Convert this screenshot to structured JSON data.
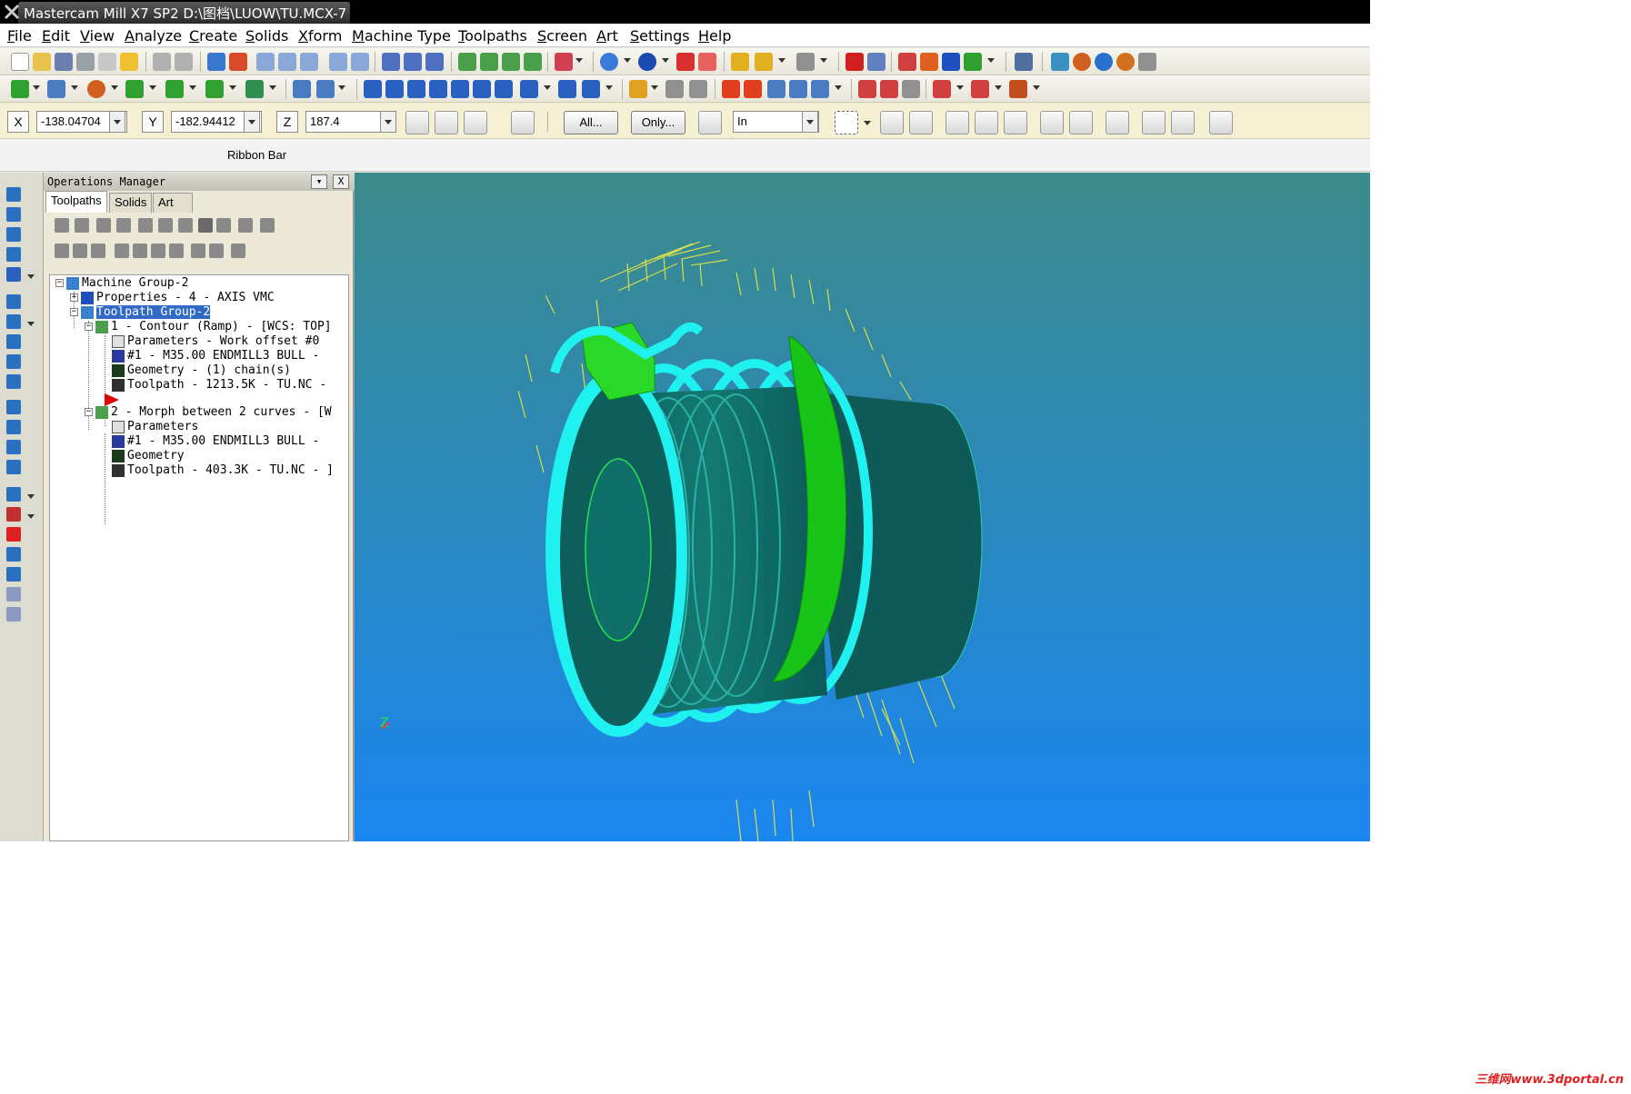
{
  "window": {
    "title": "Mastercam Mill X7 SP2  D:\\图档\\LUOW\\TU.MCX-7"
  },
  "menu": [
    "File",
    "Edit",
    "View",
    "Analyze",
    "Create",
    "Solids",
    "Xform",
    "Machine Type",
    "Toolpaths",
    "Screen",
    "Art",
    "Settings",
    "Help"
  ],
  "ribbon": {
    "x_label": "X",
    "x_value": "-138.04704",
    "y_label": "Y",
    "y_value": "-182.94412",
    "z_label": "Z",
    "z_value": "187.4",
    "all_button": "All...",
    "only_button": "Only...",
    "units_value": "In",
    "bar_label": "Ribbon Bar"
  },
  "ops_manager": {
    "title": "Operations Manager",
    "dropdown_btn": "▾",
    "close_btn": "X",
    "tabs": [
      "Toolpaths",
      "Solids",
      "Art"
    ],
    "tree": {
      "machine_group": "Machine Group-2",
      "properties": "Properties - 4 - AXIS VMC",
      "toolpath_group": "Toolpath Group-2",
      "op1": "1 - Contour (Ramp) - [WCS: TOP]",
      "op1_parameters": "Parameters - Work offset #0",
      "op1_tool": "#1 - M35.00 ENDMILL3 BULL -",
      "op1_geometry": "Geometry - (1) chain(s)",
      "op1_toolpath": "Toolpath - 1213.5K - TU.NC -",
      "op2": "2 - Morph between 2 curves - [W",
      "op2_parameters": "Parameters",
      "op2_tool": "#1 - M35.00 ENDMILL3 BULL -",
      "op2_geometry": "Geometry",
      "op2_toolpath": "Toolpath - 403.3K - TU.NC - ]"
    }
  },
  "viewport": {
    "axis_label": "Z",
    "bg_top": "#3b8a8a",
    "bg_bottom": "#1a86f0"
  },
  "watermark": "三维网www.3dportal.cn"
}
